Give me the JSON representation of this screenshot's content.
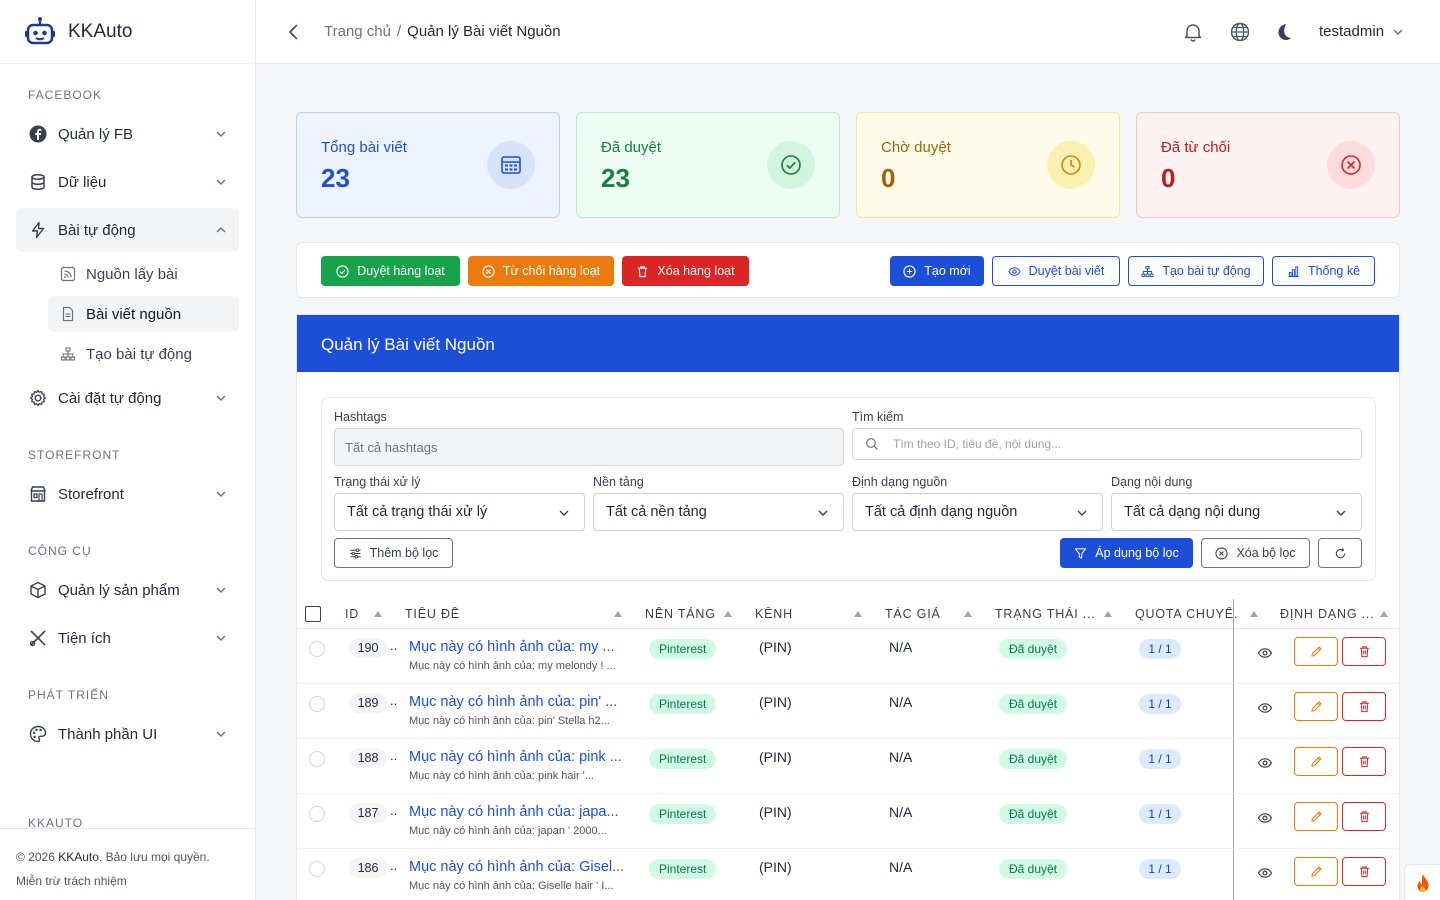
{
  "app": {
    "name": "KKAuto"
  },
  "sidebar": {
    "sections": [
      {
        "title": "FACEBOOK"
      },
      {
        "title": "STOREFRONT"
      },
      {
        "title": "CÔNG CỤ"
      },
      {
        "title": "PHÁT TRIỂN"
      },
      {
        "title": "KKAUTO"
      }
    ],
    "items": {
      "fb": "Quản lý FB",
      "data": "Dữ liệu",
      "auto_post": "Bài tự động",
      "sub_source": "Nguồn lấy bài",
      "sub_source_posts": "Bài viết nguồn",
      "sub_create_auto": "Tạo bài tự động",
      "auto_settings": "Cài đặt tự động",
      "storefront": "Storefront",
      "products": "Quản lý sản phẩm",
      "utilities": "Tiện ích",
      "ui_components": "Thành phần UI"
    },
    "footer": {
      "copyright_prefix": "© 2026",
      "brand": "KKAuto",
      "copyright_suffix": ". Bảo lưu mọi quyền.",
      "disclaimer": "Miễn trừ trách nhiệm"
    }
  },
  "header": {
    "breadcrumb_home": "Trang chủ",
    "breadcrumb_sep": "/",
    "breadcrumb_current": "Quản lý Bài viết Nguồn",
    "user": "testadmin"
  },
  "stats": [
    {
      "label": "Tổng bài viết",
      "value": "23",
      "color": "#1d4ed8",
      "bg": "#eef4ff",
      "border": "#bcd0f7",
      "circle": "#d6e3fb",
      "icon": "calendar-grid-icon"
    },
    {
      "label": "Đã duyệt",
      "value": "23",
      "color": "#15803d",
      "bg": "#ecfdf3",
      "border": "#b7ebc9",
      "circle": "#d3f5df",
      "icon": "check-circle-icon"
    },
    {
      "label": "Chờ duyệt",
      "value": "0",
      "color": "#a16207",
      "bg": "#fefbe8",
      "border": "#f5e49a",
      "circle": "#fbf0b2",
      "icon": "clock-icon"
    },
    {
      "label": "Đã từ chối",
      "value": "0",
      "color": "#b91c1c",
      "bg": "#fef1f1",
      "border": "#f7c3c3",
      "circle": "#fcdcdc",
      "icon": "x-circle-icon"
    }
  ],
  "actions": {
    "bulk_approve": "Duyệt hàng loạt",
    "bulk_reject": "Từ chối hàng loạt",
    "bulk_delete": "Xóa hàng loạt",
    "create": "Tạo mới",
    "review": "Duyệt bài viết",
    "create_auto": "Tạo bài tự động",
    "stats": "Thống kê"
  },
  "card": {
    "title": "Quản lý Bài viết Nguồn"
  },
  "filters": {
    "hashtags_label": "Hashtags",
    "hashtags_placeholder": "Tất cả hashtags",
    "search_label": "Tìm kiếm",
    "search_placeholder": "Tìm theo ID, tiêu đề, nội dung...",
    "status_label": "Trạng thái xử lý",
    "status_value": "Tất cả trạng thái xử lý",
    "platform_label": "Nền tảng",
    "platform_value": "Tất cả nền tảng",
    "format_label": "Định dạng nguồn",
    "format_value": "Tất cả định dạng nguồn",
    "content_label": "Dạng nội dung",
    "content_value": "Tất cả dạng nội dung",
    "add_filter": "Thêm bộ lọc",
    "apply": "Áp dụng bộ lọc",
    "clear": "Xóa bộ lọc"
  },
  "table": {
    "columns": {
      "id": "ID",
      "title": "TIÊU ĐỀ",
      "platform": "NỀN TẢNG",
      "channel": "KÊNH",
      "author": "TÁC GIẢ",
      "status": "TRẠNG THÁI ...",
      "quota": "QUOTA CHUYỂ...",
      "format": "ĐỊNH DẠNG ..."
    },
    "rows": [
      {
        "id": "190",
        "dots": "..",
        "title": "Mục này có hình ảnh của: my ...",
        "sub": "Mục này có hình ảnh của: my melondy ! ...",
        "platform": "Pinterest",
        "channel": "(PIN)",
        "author": "N/A",
        "status": "Đã duyệt",
        "quota": "1 / 1"
      },
      {
        "id": "189",
        "dots": "..",
        "title": "Mục này có hình ảnh của: pin' ...",
        "sub": "Mục này có hình ảnh của: pin' Stella h2...",
        "platform": "Pinterest",
        "channel": "(PIN)",
        "author": "N/A",
        "status": "Đã duyệt",
        "quota": "1 / 1"
      },
      {
        "id": "188",
        "dots": "..",
        "title": "Mục này có hình ảnh của: pink ...",
        "sub": "Mục này có hình ảnh của: pink hair '...",
        "platform": "Pinterest",
        "channel": "(PIN)",
        "author": "N/A",
        "status": "Đã duyệt",
        "quota": "1 / 1"
      },
      {
        "id": "187",
        "dots": "..",
        "title": "Mục này có hình ảnh của: japa...",
        "sub": "Mục này có hình ảnh của: japan ' 2000...",
        "platform": "Pinterest",
        "channel": "(PIN)",
        "author": "N/A",
        "status": "Đã duyệt",
        "quota": "1 / 1"
      },
      {
        "id": "186",
        "dots": "..",
        "title": "Mục này có hình ảnh của: Gisel...",
        "sub": "Mục này có hình ảnh của: Giselle hair ' I...",
        "platform": "Pinterest",
        "channel": "(PIN)",
        "author": "N/A",
        "status": "Đã duyệt",
        "quota": "1 / 1"
      }
    ]
  }
}
